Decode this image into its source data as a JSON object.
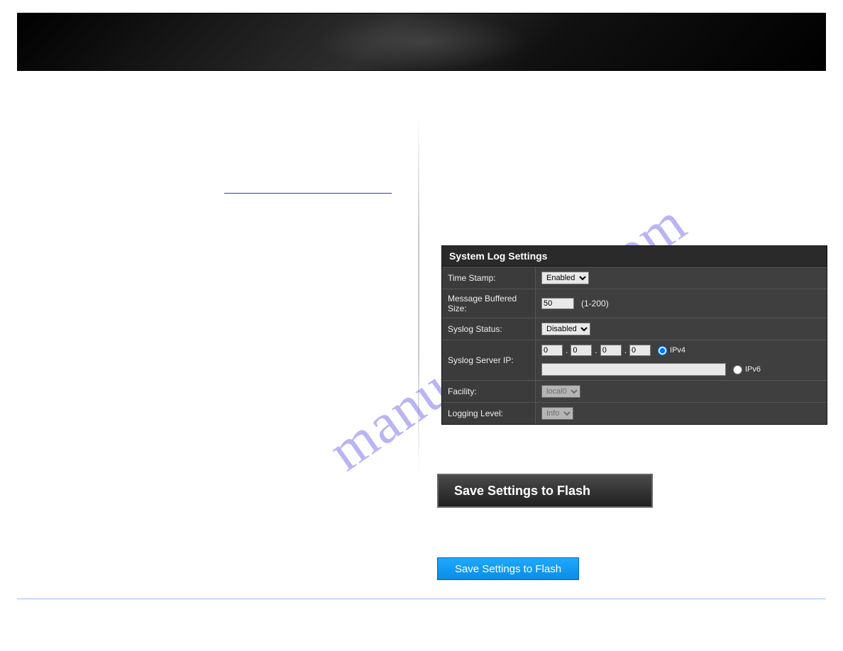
{
  "watermark": "manualshive.com",
  "panel": {
    "title": "System Log Settings",
    "rows": {
      "time_stamp": {
        "label": "Time Stamp:",
        "value": "Enabled"
      },
      "msg_buf": {
        "label": "Message Buffered Size:",
        "value": "50",
        "hint": "(1-200)"
      },
      "syslog_status": {
        "label": "Syslog Status:",
        "value": "Disabled"
      },
      "server_ip": {
        "label": "Syslog Server IP:",
        "oct1": "0",
        "oct2": "0",
        "oct3": "0",
        "oct4": "0",
        "ipv4_label": "IPv4",
        "ipv6_value": "",
        "ipv6_label": "IPv6"
      },
      "facility": {
        "label": "Facility:",
        "value": "local0"
      },
      "logging_level": {
        "label": "Logging Level:",
        "value": "Info"
      }
    }
  },
  "buttons": {
    "save_dark": "Save Settings to Flash",
    "save_blue": "Save Settings to Flash"
  }
}
